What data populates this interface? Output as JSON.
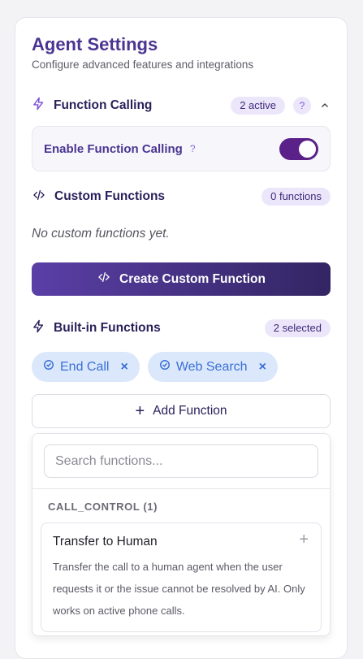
{
  "header": {
    "title": "Agent Settings",
    "subtitle": "Configure advanced features and integrations"
  },
  "function_calling": {
    "label": "Function Calling",
    "badge": "2 active",
    "help": "?",
    "expanded": true
  },
  "enable_toggle": {
    "label": "Enable Function Calling",
    "help": "?",
    "enabled": true
  },
  "custom_functions": {
    "label": "Custom Functions",
    "badge": "0 functions",
    "empty_text": "No custom functions yet.",
    "create_label": "Create Custom Function"
  },
  "builtin_functions": {
    "label": "Built-in Functions",
    "badge": "2 selected",
    "chips": [
      {
        "name": "End Call",
        "remove": "×"
      },
      {
        "name": "Web Search",
        "remove": "×"
      }
    ],
    "add_label": "Add Function"
  },
  "dropdown": {
    "search_placeholder": "Search functions...",
    "group_label": "CALL_CONTROL (1)",
    "items": [
      {
        "title": "Transfer to Human",
        "description": "Transfer the call to a human agent when the user requests it or the issue cannot be resolved by AI. Only works on active phone calls."
      }
    ]
  },
  "colors": {
    "accent": "#4a3592",
    "toggle_on": "#5a2289",
    "chip_bg": "#dbe8fb",
    "chip_text": "#3b6fd6",
    "badge_bg": "#ece6fb"
  },
  "icons": [
    "lightning-icon",
    "code-icon",
    "help-icon",
    "chevron-up-icon",
    "check-circle-icon",
    "close-icon",
    "plus-icon"
  ]
}
